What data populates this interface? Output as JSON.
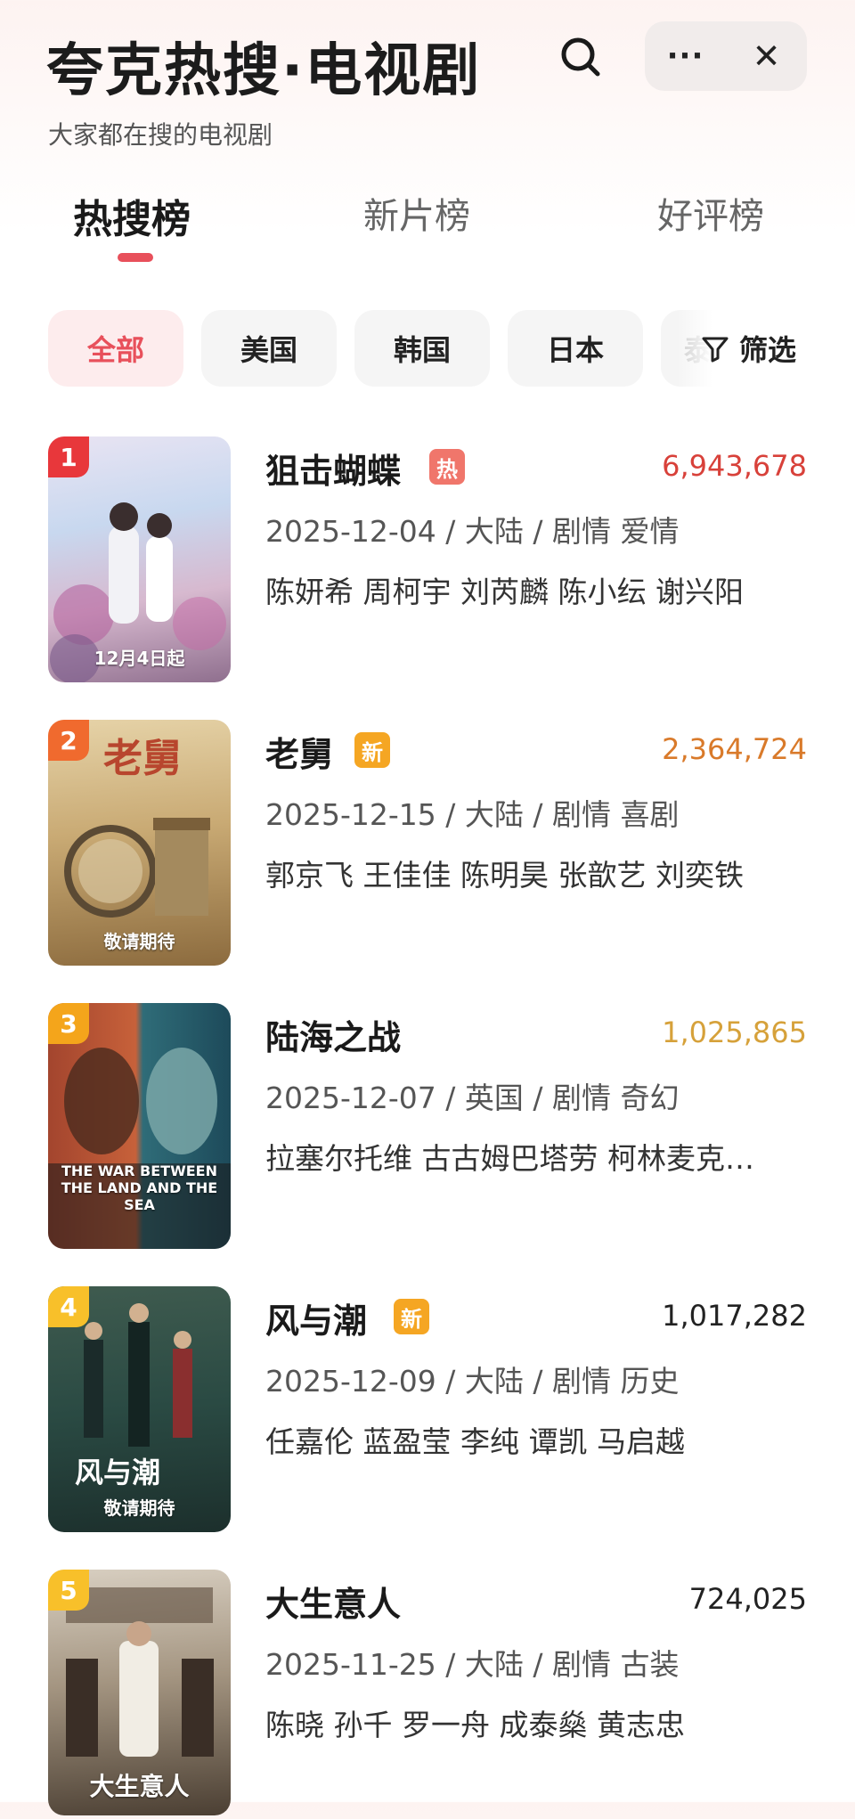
{
  "header": {
    "title": "夸克热搜·电视剧",
    "subtitle": "大家都在搜的电视剧",
    "more_label": "···",
    "close_label": "✕"
  },
  "tabs": [
    {
      "label": "热搜榜",
      "active": true
    },
    {
      "label": "新片榜",
      "active": false
    },
    {
      "label": "好评榜",
      "active": false
    }
  ],
  "filters": {
    "chips": [
      {
        "label": "全部",
        "active": true
      },
      {
        "label": "美国",
        "active": false
      },
      {
        "label": "韩国",
        "active": false
      },
      {
        "label": "日本",
        "active": false
      },
      {
        "label": "泰",
        "active": false
      }
    ],
    "filter_label": "筛选"
  },
  "colors": {
    "accent": "#e8505b",
    "rank1": "#e8373b",
    "rank2": "#f06a2e",
    "rank3": "#f4a51b",
    "rank4_5": "#f8c02a"
  },
  "items": [
    {
      "rank": "1",
      "name": "狙击蝴蝶",
      "badge": "热",
      "badge_type": "hot",
      "count": "6,943,678",
      "count_color": "#d8413a",
      "meta": "2025-12-04 / 大陆 / 剧情 爱情",
      "cast": "陈妍希 周柯宇 刘芮麟 陈小纭 谢兴阳",
      "poster_caption": "12月4日起"
    },
    {
      "rank": "2",
      "name": "老舅",
      "badge": "新",
      "badge_type": "new",
      "count": "2,364,724",
      "count_color": "#d97a2a",
      "meta": "2025-12-15 / 大陆 / 剧情 喜剧",
      "cast": "郭京飞 王佳佳 陈明昊 张歆艺 刘奕铁",
      "poster_caption": "敬请期待"
    },
    {
      "rank": "3",
      "name": "陆海之战",
      "badge": "",
      "badge_type": "",
      "count": "1,025,865",
      "count_color": "#d6a13a",
      "meta": "2025-12-07 / 英国 / 剧情 奇幻",
      "cast": "拉塞尔托维 古古姆巴塔劳 柯林麦克…",
      "poster_caption": "THE WAR BETWEEN THE LAND AND THE SEA"
    },
    {
      "rank": "4",
      "name": "风与潮",
      "badge": "新",
      "badge_type": "new",
      "count": "1,017,282",
      "count_color": "#222222",
      "meta": "2025-12-09 / 大陆 / 剧情 历史",
      "cast": "任嘉伦 蓝盈莹 李纯 谭凯 马启越",
      "poster_caption": "敬请期待"
    },
    {
      "rank": "5",
      "name": "大生意人",
      "badge": "",
      "badge_type": "",
      "count": "724,025",
      "count_color": "#222222",
      "meta": "2025-11-25 / 大陆 / 剧情 古装",
      "cast": "陈晓 孙千 罗一舟 成泰燊 黄志忠",
      "poster_caption": "大生意人"
    }
  ]
}
